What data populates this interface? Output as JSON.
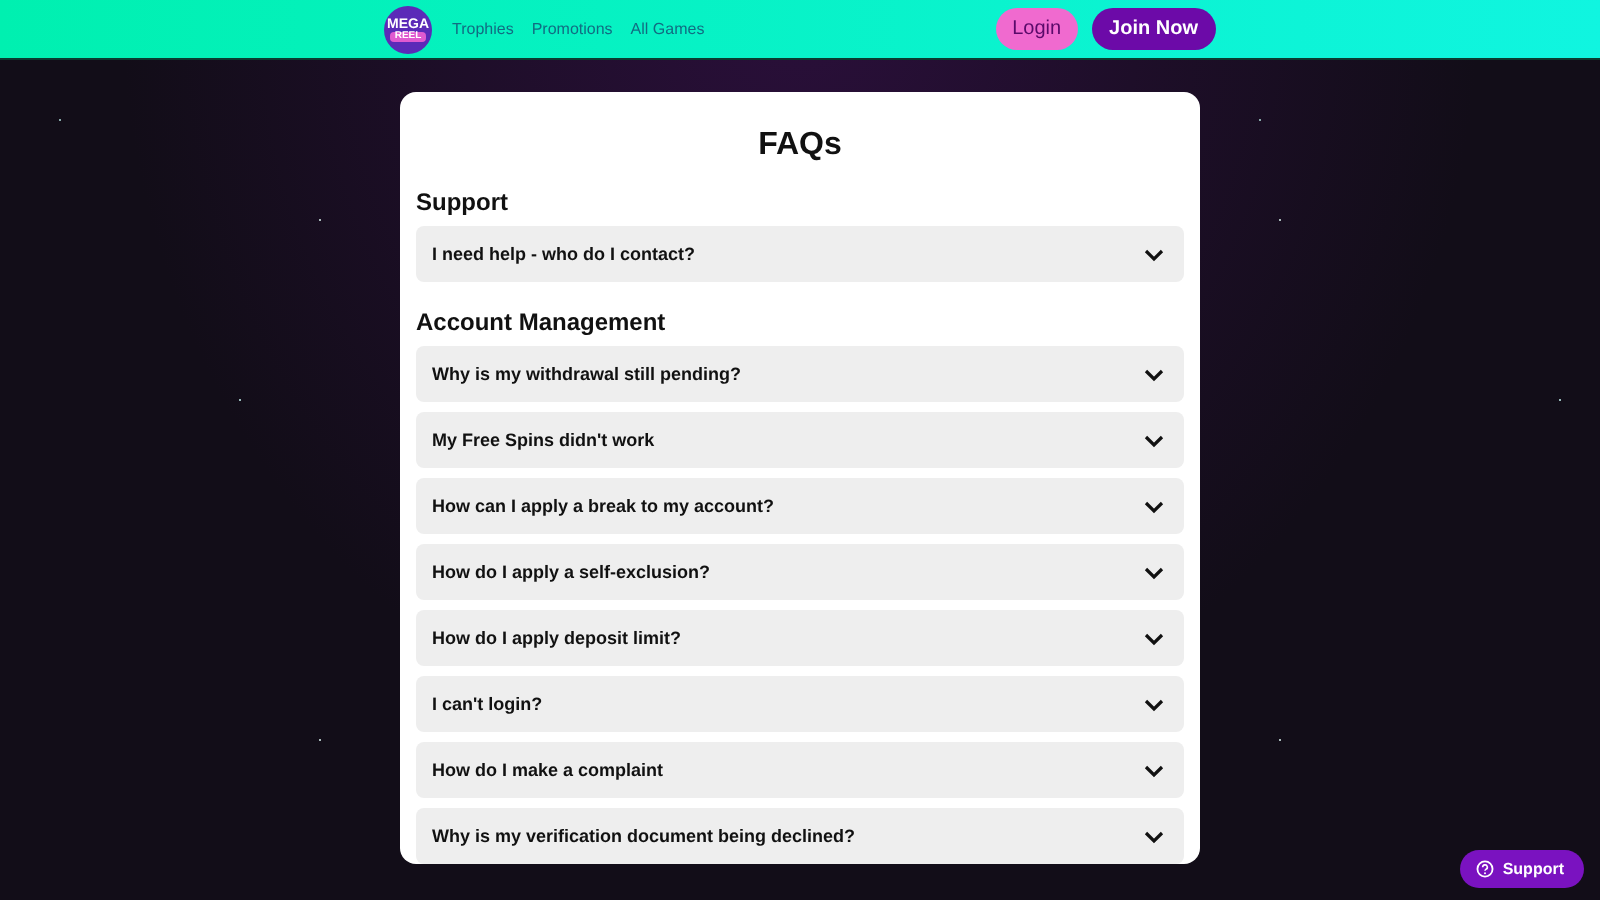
{
  "header": {
    "logo": [
      "MEGA",
      "REEL"
    ],
    "nav": [
      {
        "label": "Trophies"
      },
      {
        "label": "Promotions"
      },
      {
        "label": "All Games"
      }
    ],
    "login": "Login",
    "join": "Join Now"
  },
  "title": "FAQs",
  "sections": [
    {
      "heading": "Support",
      "items": [
        {
          "question": "I need help - who do I contact?",
          "expanded": false
        }
      ]
    },
    {
      "heading": "Account Management",
      "items": [
        {
          "question": "Why is my withdrawal still pending?",
          "expanded": false
        },
        {
          "question": "My Free Spins didn't work",
          "expanded": false
        },
        {
          "question": "How can I apply a break to my account?",
          "expanded": false
        },
        {
          "question": "How do I apply a self-exclusion?",
          "expanded": false
        },
        {
          "question": "How do I apply deposit limit?",
          "expanded": false
        },
        {
          "question": "I can't login?",
          "expanded": false
        },
        {
          "question": "How do I make a complaint",
          "expanded": false
        },
        {
          "question": "Why is my verification document being declined?",
          "expanded": false
        }
      ]
    }
  ],
  "support_button": "Support"
}
